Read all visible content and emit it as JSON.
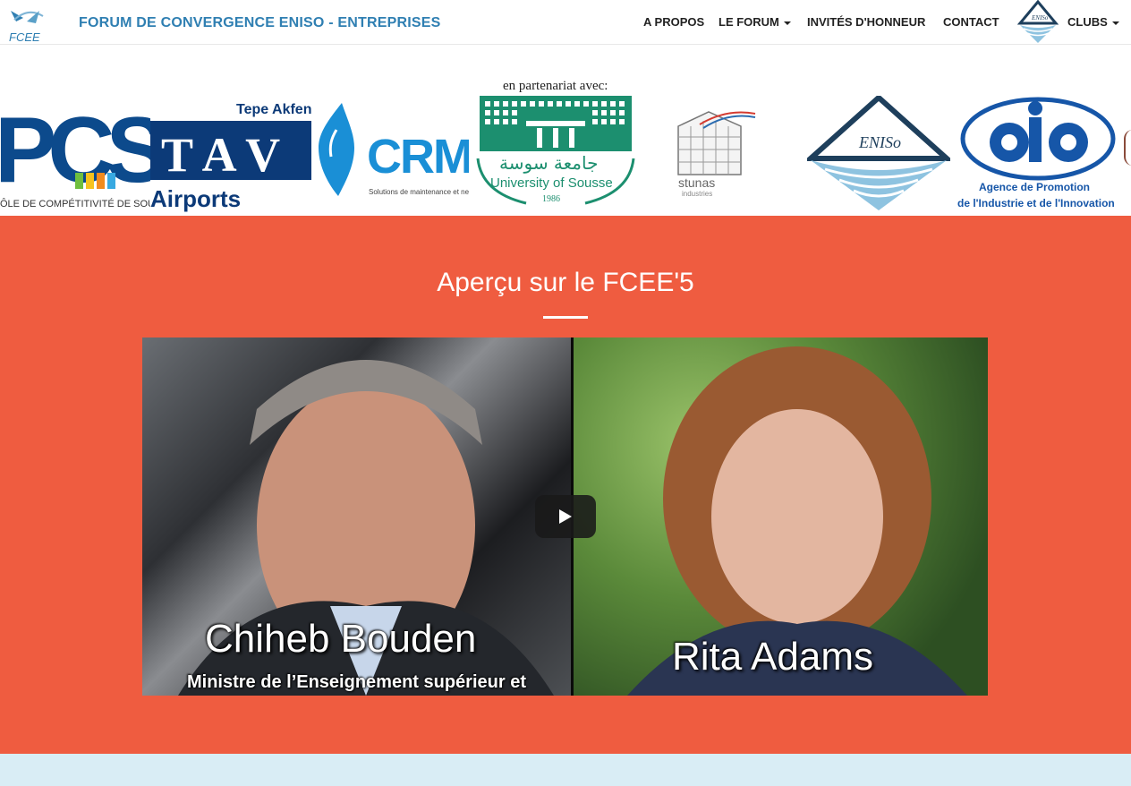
{
  "nav": {
    "logo_text": "FCEE",
    "title": "FORUM DE CONVERGENCE ENISO - ENTREPRISES",
    "items": [
      {
        "label": "A PROPOS"
      },
      {
        "label": "LE FORUM"
      },
      {
        "label": "INVITÉS D'HONNEUR"
      },
      {
        "label": "CONTACT"
      },
      {
        "label": "CLUBS"
      }
    ],
    "clubs_logo_text": "ENISo"
  },
  "partners": {
    "label": "en partenariat avec:",
    "logos": {
      "pcs": {
        "main": "PCS",
        "sub": "ÔLE DE COMPÉTITIVITÉ DE SOUSSE"
      },
      "tav": {
        "top": "Tepe Akfen",
        "letters": "T A V",
        "bottom": "Airports"
      },
      "crmn": {
        "main": "CRMN",
        "sub": "Solutions de maintenance et nettoyage"
      },
      "sousse": {
        "arabic": "جامعة سوسة",
        "english": "University of Sousse",
        "year": "1986"
      },
      "stunas": {
        "main": "stunas",
        "sub": "industries"
      },
      "eniso": {
        "text": "ENISo"
      },
      "apii": {
        "line1": "Agence de Promotion",
        "line2": "de l'Industrie et de l'Innovation"
      }
    }
  },
  "video_section": {
    "title": "Aperçu sur le FCEE'5",
    "left_name": "Chiheb Bouden",
    "left_caption": "Ministre de l’Enseignement supérieur et",
    "right_name": "Rita Adams"
  },
  "colors": {
    "brand_blue": "#2f7fb2",
    "section_bg": "#ef5c40",
    "bottom_band": "#d9edf5"
  }
}
